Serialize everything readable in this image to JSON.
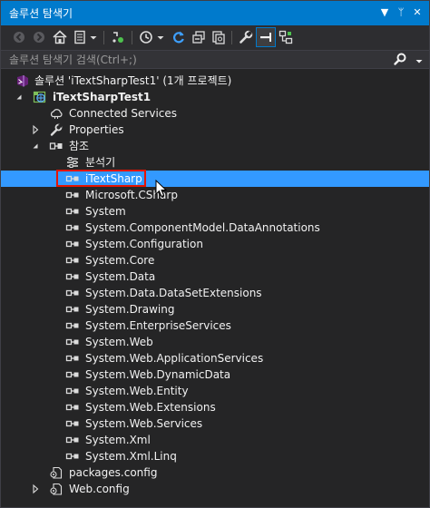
{
  "window": {
    "title": "솔루션 탐색기"
  },
  "titlebar": {
    "menu_glyph": "▼",
    "pin_glyph": "ᛘ",
    "close_glyph": "✕"
  },
  "search": {
    "placeholder": "솔루션 탐색기 검색(Ctrl+;)"
  },
  "tree": [
    {
      "label": "솔루션 'iTextSharpTest1' (1개 프로젝트)",
      "icon": "solution-icon",
      "indent": 0,
      "arrow": "none",
      "bold": false
    },
    {
      "label": "iTextSharpTest1",
      "icon": "web-project-icon",
      "indent": 1,
      "arrow": "expanded",
      "bold": true
    },
    {
      "label": "Connected Services",
      "icon": "connected-services-icon",
      "indent": 2,
      "arrow": "none",
      "bold": false
    },
    {
      "label": "Properties",
      "icon": "wrench-icon",
      "indent": 2,
      "arrow": "collapsed",
      "bold": false
    },
    {
      "label": "참조",
      "icon": "references-icon",
      "indent": 2,
      "arrow": "expanded",
      "bold": false
    },
    {
      "label": "분석기",
      "icon": "analyzer-icon",
      "indent": 3,
      "arrow": "none",
      "bold": false
    },
    {
      "label": "iTextSharp",
      "icon": "reference-icon",
      "indent": 3,
      "arrow": "none",
      "bold": false,
      "selected": true
    },
    {
      "label": "Microsoft.CSharp",
      "icon": "reference-icon",
      "indent": 3,
      "arrow": "none",
      "bold": false
    },
    {
      "label": "System",
      "icon": "reference-icon",
      "indent": 3,
      "arrow": "none",
      "bold": false
    },
    {
      "label": "System.ComponentModel.DataAnnotations",
      "icon": "reference-icon",
      "indent": 3,
      "arrow": "none",
      "bold": false
    },
    {
      "label": "System.Configuration",
      "icon": "reference-icon",
      "indent": 3,
      "arrow": "none",
      "bold": false
    },
    {
      "label": "System.Core",
      "icon": "reference-icon",
      "indent": 3,
      "arrow": "none",
      "bold": false
    },
    {
      "label": "System.Data",
      "icon": "reference-icon",
      "indent": 3,
      "arrow": "none",
      "bold": false
    },
    {
      "label": "System.Data.DataSetExtensions",
      "icon": "reference-icon",
      "indent": 3,
      "arrow": "none",
      "bold": false
    },
    {
      "label": "System.Drawing",
      "icon": "reference-icon",
      "indent": 3,
      "arrow": "none",
      "bold": false
    },
    {
      "label": "System.EnterpriseServices",
      "icon": "reference-icon",
      "indent": 3,
      "arrow": "none",
      "bold": false
    },
    {
      "label": "System.Web",
      "icon": "reference-icon",
      "indent": 3,
      "arrow": "none",
      "bold": false
    },
    {
      "label": "System.Web.ApplicationServices",
      "icon": "reference-icon",
      "indent": 3,
      "arrow": "none",
      "bold": false
    },
    {
      "label": "System.Web.DynamicData",
      "icon": "reference-icon",
      "indent": 3,
      "arrow": "none",
      "bold": false
    },
    {
      "label": "System.Web.Entity",
      "icon": "reference-icon",
      "indent": 3,
      "arrow": "none",
      "bold": false
    },
    {
      "label": "System.Web.Extensions",
      "icon": "reference-icon",
      "indent": 3,
      "arrow": "none",
      "bold": false
    },
    {
      "label": "System.Web.Services",
      "icon": "reference-icon",
      "indent": 3,
      "arrow": "none",
      "bold": false
    },
    {
      "label": "System.Xml",
      "icon": "reference-icon",
      "indent": 3,
      "arrow": "none",
      "bold": false
    },
    {
      "label": "System.Xml.Linq",
      "icon": "reference-icon",
      "indent": 3,
      "arrow": "none",
      "bold": false
    },
    {
      "label": "packages.config",
      "icon": "config-file-icon",
      "indent": 2,
      "arrow": "none",
      "bold": false
    },
    {
      "label": "Web.config",
      "icon": "config-file-icon",
      "indent": 2,
      "arrow": "collapsed",
      "bold": false
    }
  ],
  "colors": {
    "accent": "#007acc",
    "selection": "#3399ff",
    "highlight_border": "#e51400",
    "background": "#252526"
  }
}
